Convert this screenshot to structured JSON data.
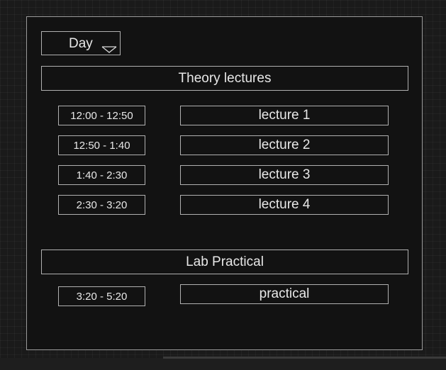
{
  "day_selector": {
    "label": "Day",
    "caret_icon": "chevron-down-icon"
  },
  "theory": {
    "heading": "Theory lectures",
    "slots": [
      {
        "time": "12:00 - 12:50",
        "session": "lecture 1"
      },
      {
        "time": "12:50 - 1:40",
        "session": "lecture 2"
      },
      {
        "time": "1:40 - 2:30",
        "session": "lecture 3"
      },
      {
        "time": "2:30 - 3:20",
        "session": "lecture 4"
      }
    ]
  },
  "lab": {
    "heading": "Lab Practical",
    "slots": [
      {
        "time": "3:20 - 5:20",
        "session": "practical"
      }
    ]
  },
  "colors": {
    "background": "#1a1a1a",
    "panel": "#121212",
    "border": "#b0b0b0",
    "text": "#e8e8e8"
  }
}
